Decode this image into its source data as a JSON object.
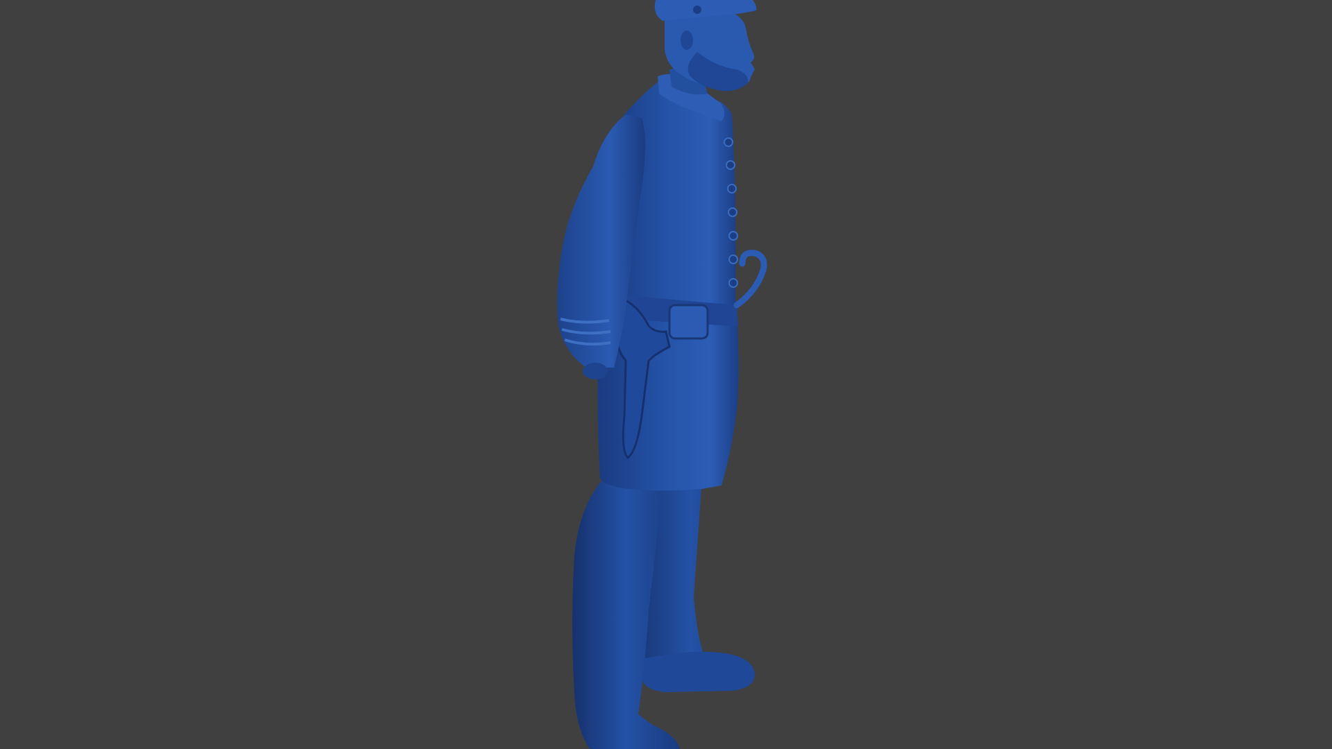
{
  "viewport": {
    "background_color": "#404040",
    "subject": {
      "kind": "sculpt-render",
      "material_color": "#2452a6",
      "shadow_color": "#16316e",
      "highlight_color": "#3f70c4"
    }
  }
}
